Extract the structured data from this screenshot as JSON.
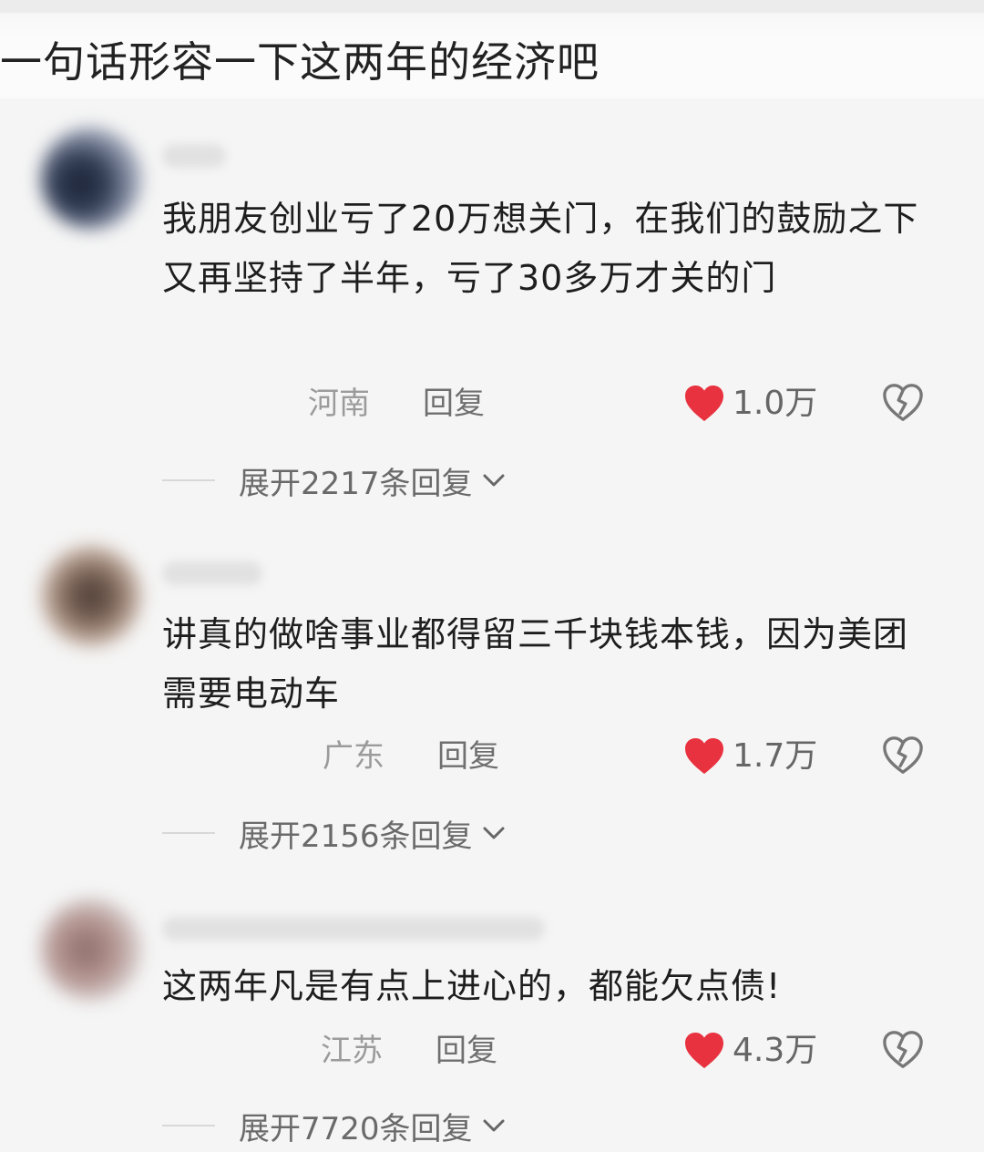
{
  "post": {
    "title": "一句话形容一下这两年的经济吧"
  },
  "comments": [
    {
      "text": "我朋友创业亏了20万想关门，在我们的鼓励之下又再坚持了半年，亏了30多万才关的门",
      "location": "河南",
      "reply_label": "回复",
      "likes": "1.0万",
      "expand_label": "展开2217条回复"
    },
    {
      "text": "讲真的做啥事业都得留三千块钱本钱，因为美团需要电动车",
      "location": "广东",
      "reply_label": "回复",
      "likes": "1.7万",
      "expand_label": "展开2156条回复"
    },
    {
      "text": "这两年凡是有点上进心的，都能欠点债!",
      "location": "江苏",
      "reply_label": "回复",
      "likes": "4.3万",
      "expand_label": "展开7720条回复"
    }
  ],
  "colors": {
    "like_red": "#e8323f",
    "text_primary": "#1e1e1e",
    "text_meta": "#9b9b9b"
  },
  "icons": {
    "like": "heart-icon",
    "dislike": "broken-heart-icon",
    "expand": "chevron-down-icon"
  }
}
